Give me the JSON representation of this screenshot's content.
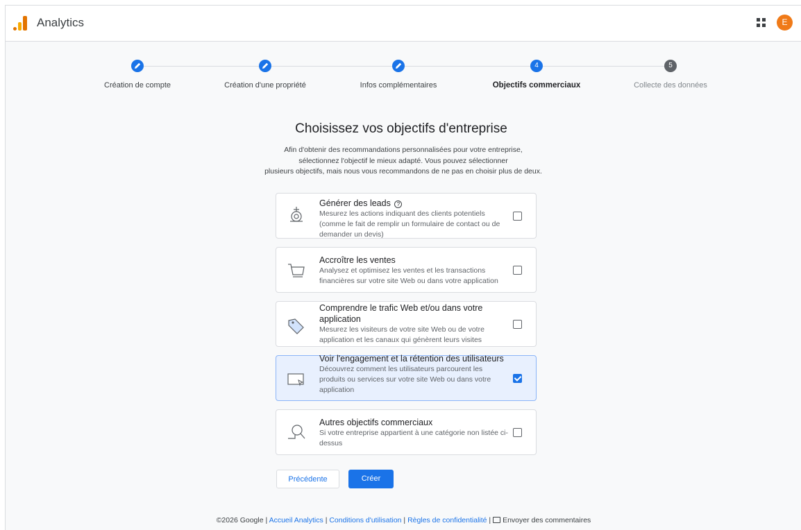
{
  "header": {
    "app_title": "Analytics",
    "avatar_letter": "E"
  },
  "stepper": {
    "steps": [
      {
        "label": "Création de compte",
        "state": "done",
        "icon": "edit-pencil"
      },
      {
        "label": "Création d'une propriété",
        "state": "done",
        "icon": "edit-pencil"
      },
      {
        "label": "Infos complémentaires",
        "state": "done",
        "icon": "edit-pencil"
      },
      {
        "label": "Objectifs commerciaux",
        "state": "active",
        "number": "4"
      },
      {
        "label": "Collecte des données",
        "state": "pending",
        "number": "5"
      }
    ]
  },
  "main": {
    "heading": "Choisissez vos objectifs d'entreprise",
    "intro_lines": [
      "Afin d'obtenir des recommandations personnalisées pour votre entreprise,",
      "sélectionnez l'objectif le mieux adapté. Vous pouvez sélectionner",
      "plusieurs objectifs, mais nous vous recommandons de ne pas en choisir plus de deux."
    ],
    "objectives": [
      {
        "title": "Générer des leads",
        "help_icon": "help-circle-icon",
        "description": "Mesurez les actions indiquant des clients potentiels (comme le fait de remplir un formulaire de contact ou de demander un devis)",
        "checked": false,
        "icon": "leads-target-icon"
      },
      {
        "title": "Accroître les ventes",
        "description": "Analysez et optimisez les ventes et les transactions financières sur votre site Web ou dans votre application",
        "checked": false,
        "icon": "shopping-cart-icon"
      },
      {
        "title": "Comprendre le trafic Web et/ou dans votre application",
        "description": "Mesurez les visiteurs de votre site Web ou de votre application et les canaux qui génèrent leurs visites",
        "checked": false,
        "icon": "tag-icon"
      },
      {
        "title": "Voir l'engagement et la rétention des utilisateurs",
        "description": "Découvrez comment les utilisateurs parcourent les produits ou services sur votre site Web ou dans votre application",
        "checked": true,
        "icon": "screen-cursor-icon"
      },
      {
        "title": "Autres objectifs commerciaux",
        "description": "Si votre entreprise appartient à une catégorie non listée ci-dessus",
        "checked": false,
        "icon": "magnifier-icon"
      }
    ]
  },
  "actions": {
    "previous_label": "Précédente",
    "create_label": "Créer"
  },
  "footer": {
    "copyright": "©2026 Google",
    "sep": "|",
    "links": [
      "Accueil Analytics",
      "Conditions d'utilisation",
      "Règles de confidentialité"
    ],
    "feedback_label": "Envoyer des commentaires"
  },
  "colors": {
    "primary": "#1a73e8",
    "analytics_orange": "#e37400",
    "analytics_yellow": "#f9ab00",
    "avatar": "#f07a18",
    "selected_bg": "#e8f0fe"
  }
}
